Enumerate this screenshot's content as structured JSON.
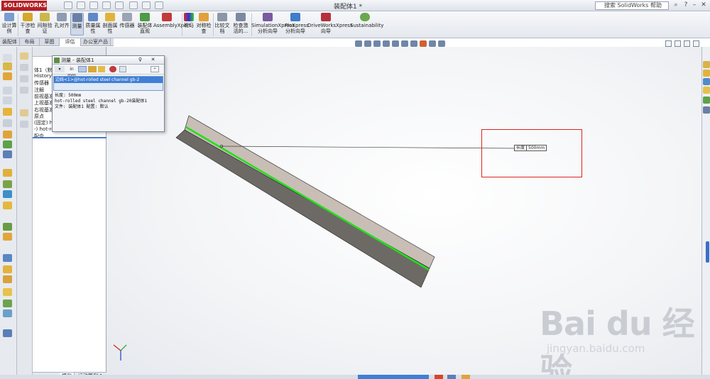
{
  "app": {
    "logo_text": "SOLIDWORKS",
    "window_title": "装配体1 *",
    "search_placeholder": "搜索 SolidWorks 帮助"
  },
  "ribbon": {
    "items": [
      {
        "label": "设计算例"
      },
      {
        "label": "干涉检查"
      },
      {
        "label": "间隙验证"
      },
      {
        "label": "孔对齐"
      },
      {
        "label": "测量"
      },
      {
        "label": "质量属性"
      },
      {
        "label": "剖面属性"
      },
      {
        "label": "传感器"
      },
      {
        "label": "装配体直观"
      },
      {
        "label": "AssemblyXpert"
      },
      {
        "label": "斑马"
      },
      {
        "label": "对称检查"
      },
      {
        "label": "比较文档"
      },
      {
        "label": "检查激活的..."
      },
      {
        "label": "SimulationXpress 分析向导"
      },
      {
        "label": "FloXpress 分析向导"
      },
      {
        "label": "DriveWorksXpress 向导"
      },
      {
        "label": "Sustainability"
      }
    ]
  },
  "tabs": [
    {
      "label": "装配体"
    },
    {
      "label": "布局"
    },
    {
      "label": "草图"
    },
    {
      "label": "评估"
    },
    {
      "label": "办公室产品"
    }
  ],
  "tree": {
    "rows": [
      {
        "text": "体1（默"
      },
      {
        "text": "History"
      },
      {
        "text": "传感器"
      },
      {
        "text": "注解"
      },
      {
        "text": "前视基准"
      },
      {
        "text": "上视基准"
      },
      {
        "text": "右视基准"
      },
      {
        "text": "原点"
      },
      {
        "text": "(固定) ho"
      },
      {
        "text": "-) hot-ro"
      },
      {
        "text": "配合"
      }
    ],
    "bottom_tab": "模型",
    "bottom_tab2": "运动算例 1"
  },
  "measure_dialog": {
    "title": "测量 - 装配体1",
    "pin_symbol": "♀",
    "close_symbol": "✕",
    "units_label": "in mm",
    "selection": "边线<1>@hot-rolled steel channel gb-2",
    "result_length": "长度: 500mm",
    "result_part": "hot-rolled steel channel gb-20装配体1",
    "result_file": "文件: 装配体1 配置: 默认"
  },
  "dimension": {
    "label": "长度",
    "value": "500mm"
  },
  "watermark": {
    "big": "Bai du 经验",
    "small": "jingyan.baidu.com"
  },
  "colors": {
    "accent_blue": "#3367b5",
    "edge_highlight": "#22e01b",
    "annotation_red": "#e0241f",
    "beam_top": "#c8beb6",
    "beam_side": "#6d6a66"
  }
}
